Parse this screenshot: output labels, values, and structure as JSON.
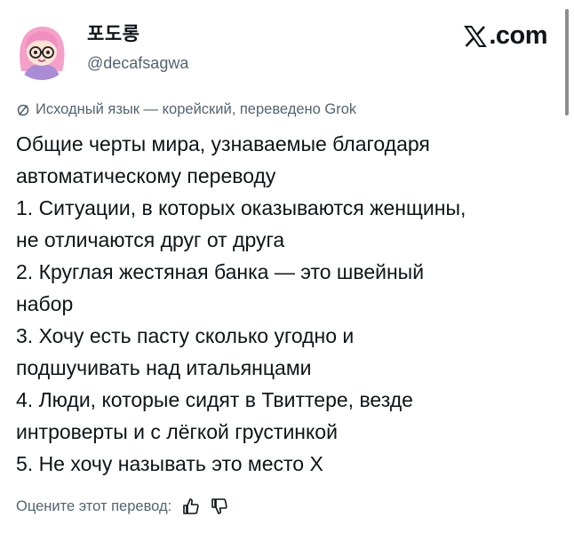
{
  "author": {
    "display_name": "포도롱",
    "handle": "@decafsagwa",
    "avatar_icon": "pink-hair-character-avatar"
  },
  "brand": {
    "text": ".com",
    "icon": "x-logo-icon"
  },
  "translation_note": {
    "icon": "translate-icon",
    "text": "Исходный язык — корейский, переведено Grok"
  },
  "tweet": {
    "lines": [
      "Общие черты мира, узнаваемые благодаря",
      "автоматическому переводу",
      "1. Ситуации, в которых оказываются женщины,",
      "не отличаются друг от друга",
      "2. Круглая жестяная банка — это швейный",
      "набор",
      "3. Хочу есть пасту сколько угодно и",
      "подшучивать над итальянцами",
      "4. Люди, которые сидят в Твиттере, везде",
      "интроверты и с лёгкой грустинкой",
      "5. Не хочу называть это место X"
    ]
  },
  "rating": {
    "label": "Оцените этот перевод:",
    "thumbs_up_icon": "thumbs-up-icon",
    "thumbs_down_icon": "thumbs-down-icon"
  },
  "colors": {
    "text": "#0f1419",
    "secondary": "#536471",
    "avatar_hair": "#f4a0c8",
    "avatar_shirt": "#a98bd6"
  }
}
